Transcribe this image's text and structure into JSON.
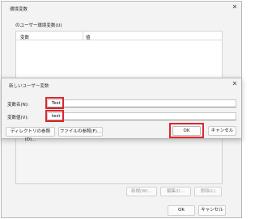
{
  "env_window": {
    "title": "環境変数",
    "close_glyph": "✕",
    "user_section_label": "のユーザー環境変数(U)",
    "table_headers": [
      "変数",
      "値"
    ],
    "buttons": {
      "new": "新規(W)...",
      "edit": "編集(I)...",
      "delete": "削除(L)"
    },
    "footer": {
      "ok": "OK",
      "cancel": "キャンセル"
    }
  },
  "dialog": {
    "title": "新しいユーザー変数",
    "close_glyph": "✕",
    "name_label": "変数名(N):",
    "name_value": "Test",
    "value_label": "変数値(V):",
    "value_value": "test",
    "browse_dir_button": "ディレクトリの参照(D)...",
    "browse_file_button": "ファイルの参照(F)...",
    "ok_button": "OK",
    "cancel_button": "キャンセル"
  },
  "colors": {
    "highlight": "#e0262b",
    "window_bg": "#f3f3f3"
  }
}
